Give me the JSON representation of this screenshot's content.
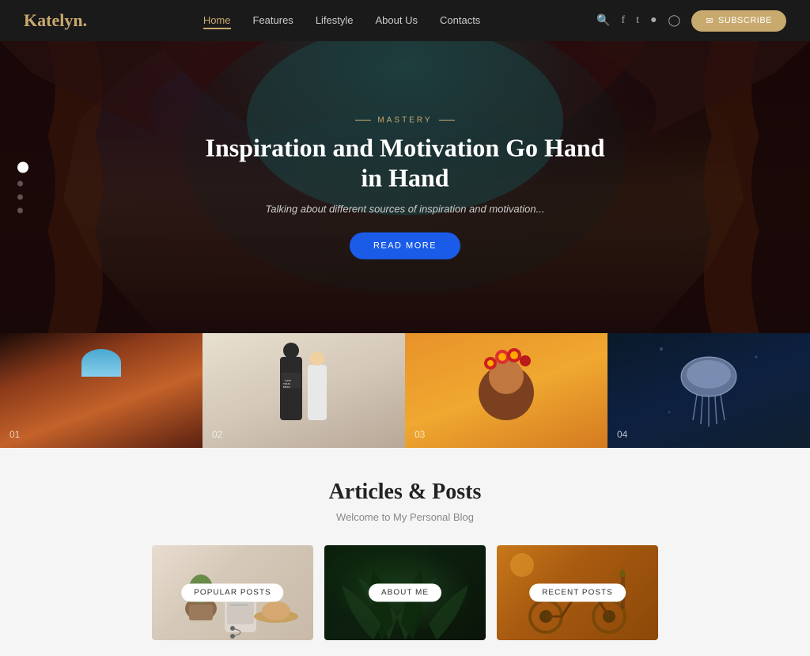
{
  "logo": {
    "text": "Katelyn",
    "dot": "."
  },
  "nav": {
    "links": [
      {
        "label": "Home",
        "active": true
      },
      {
        "label": "Features",
        "active": false
      },
      {
        "label": "Lifestyle",
        "active": false
      },
      {
        "label": "About Us",
        "active": false
      },
      {
        "label": "Contacts",
        "active": false
      }
    ],
    "subscribe_label": "SUBSCRIBE"
  },
  "hero": {
    "tag": "MASTERY",
    "title": "Inspiration and Motivation Go Hand in Hand",
    "subtitle": "Talking about different sources of inspiration and motivation...",
    "read_more": "READ MORE"
  },
  "photo_strip": [
    {
      "num": "01"
    },
    {
      "num": "02"
    },
    {
      "num": "03"
    },
    {
      "num": "04"
    }
  ],
  "articles": {
    "title": "Articles & Posts",
    "subtitle": "Welcome to My Personal Blog",
    "cards": [
      {
        "label": "POPULAR POSTS"
      },
      {
        "label": "ABOUT ME"
      },
      {
        "label": "RECENT POSTS"
      }
    ]
  }
}
